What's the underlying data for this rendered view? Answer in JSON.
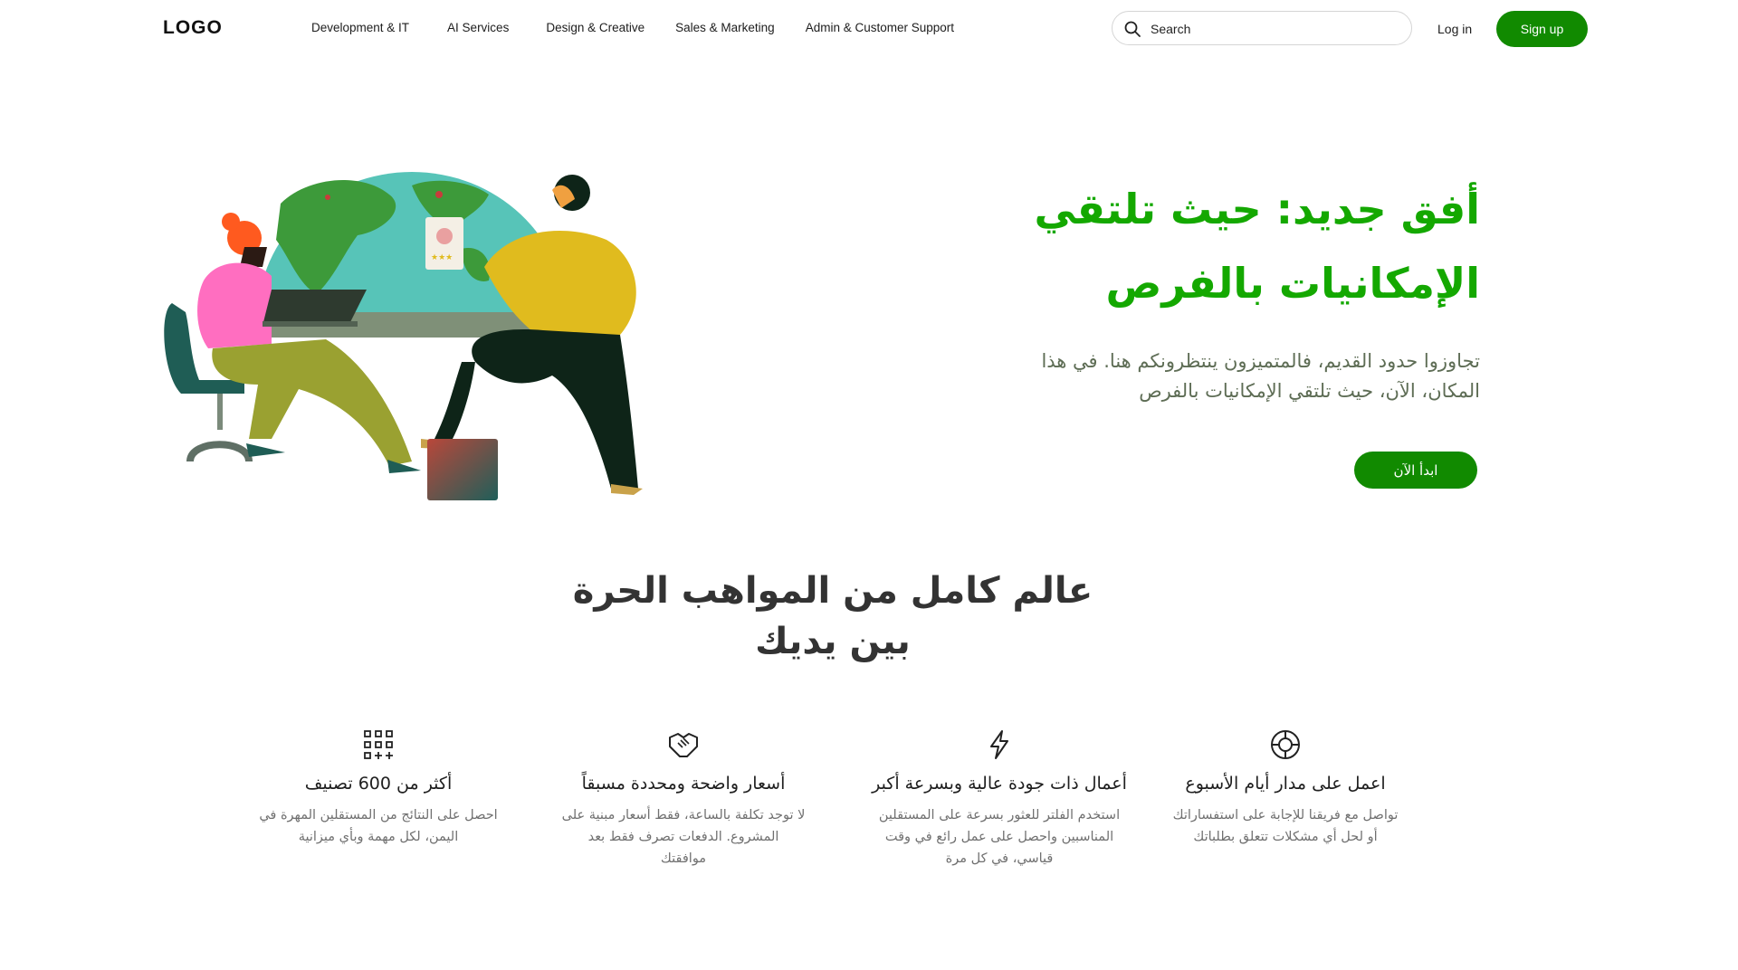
{
  "header": {
    "logo": "LOGO",
    "nav": [
      "Development & IT",
      "AI Services",
      "Design & Creative",
      "Sales & Marketing",
      "Admin & Customer Support"
    ],
    "search": {
      "placeholder": "Search",
      "icon": "search-icon"
    },
    "login_label": "Log in",
    "signup_label": "Sign up"
  },
  "hero": {
    "title_line1": "أفق جديد: حيث تلتقي",
    "title_line2": "الإمكانيات بالفرص",
    "subtitle_line1": "تجاوزوا حدود القديم، فالمتميزون ينتظرونكم هنا. في هذا",
    "subtitle_line2": "المكان، الآن، حيث تلتقي الإمكانيات بالفرص",
    "cta_label": "ابدأ الآن",
    "title_color": "#14a800"
  },
  "section": {
    "title_line1": "عالم كامل من المواهب الحرة",
    "title_line2": "بين يديك"
  },
  "features": [
    {
      "icon": "lifebuoy-icon",
      "title": "اعمل على مدار أيام الأسبوع",
      "desc_line1": "تواصل مع فريقنا للإجابة على استفساراتك",
      "desc_line2": "أو لحل أي مشكلات تتعلق بطلباتك",
      "desc_line3": ""
    },
    {
      "icon": "lightning-icon",
      "title": "أعمال ذات جودة عالية وبسرعة أكبر",
      "desc_line1": "استخدم الفلتر للعثور بسرعة على المستقلين",
      "desc_line2": "المناسبين واحصل على عمل رائع في وقت",
      "desc_line3": "قياسي، في كل مرة"
    },
    {
      "icon": "handshake-icon",
      "title": "أسعار واضحة ومحددة مسبقاً",
      "desc_line1": "لا توجد تكلفة بالساعة، فقط أسعار مبنية على",
      "desc_line2": "المشروع. الدفعات تصرف فقط بعد",
      "desc_line3": "موافقتك"
    },
    {
      "icon": "grid-plus-icon",
      "title": "أكثر من 600 تصنيف",
      "desc_line1": "احصل على النتائج من المستقلين المهرة في",
      "desc_line2": "اليمن، لكل مهمة وبأي ميزانية",
      "desc_line3": ""
    }
  ],
  "colors": {
    "brand_green": "#118a00",
    "accent_green": "#14a800",
    "muted_text": "#707070"
  }
}
